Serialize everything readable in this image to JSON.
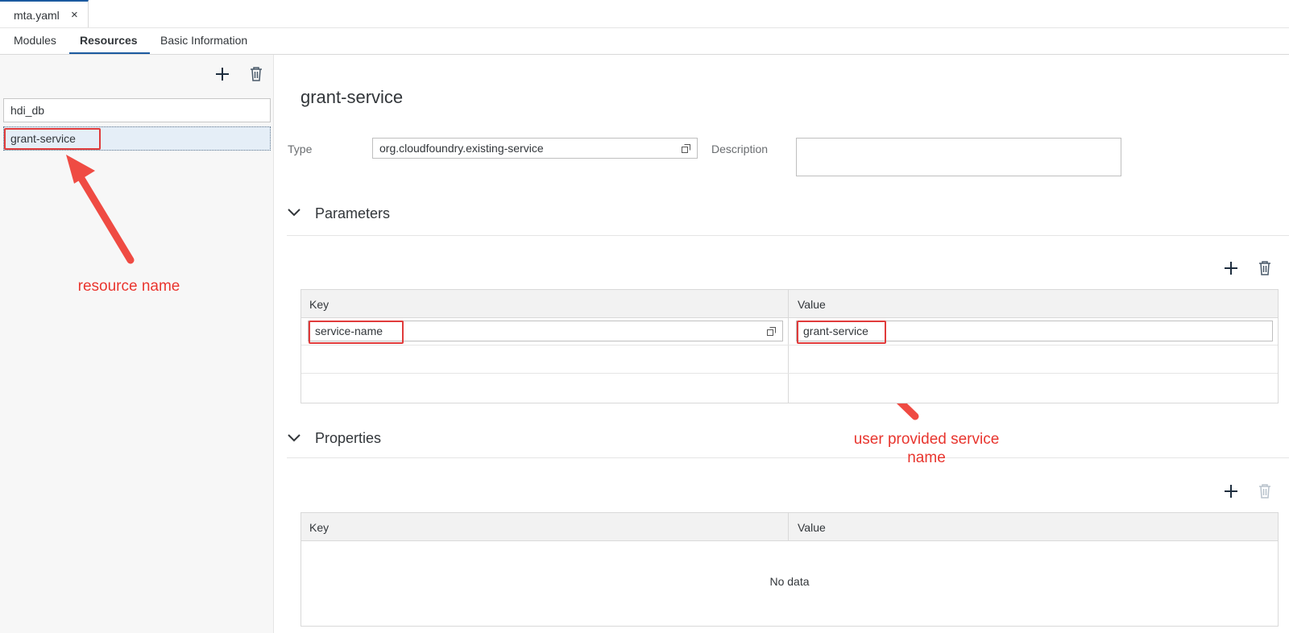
{
  "editor_tab": {
    "label": "mta.yaml",
    "close": "×"
  },
  "view_tabs": [
    {
      "label": "Modules"
    },
    {
      "label": "Resources"
    },
    {
      "label": "Basic Information"
    }
  ],
  "resources_list": {
    "items": [
      {
        "label": "hdi_db"
      },
      {
        "label": "grant-service"
      }
    ]
  },
  "resource": {
    "title": "grant-service",
    "type_label": "Type",
    "type_value": "org.cloudfoundry.existing-service",
    "description_label": "Description",
    "description_value": ""
  },
  "parameters": {
    "title": "Parameters",
    "columns": [
      "Key",
      "Value"
    ],
    "rows": [
      {
        "key": "service-name",
        "value": "grant-service"
      }
    ]
  },
  "properties": {
    "title": "Properties",
    "columns": [
      "Key",
      "Value"
    ],
    "empty_text": "No data"
  },
  "annotations": {
    "resource_name": "resource name",
    "user_service_line1": "user provided service",
    "user_service_line2": "name"
  },
  "colors": {
    "accent": "#1b5aa0",
    "annotation": "#e8352e",
    "selection": "#e5eef7"
  }
}
